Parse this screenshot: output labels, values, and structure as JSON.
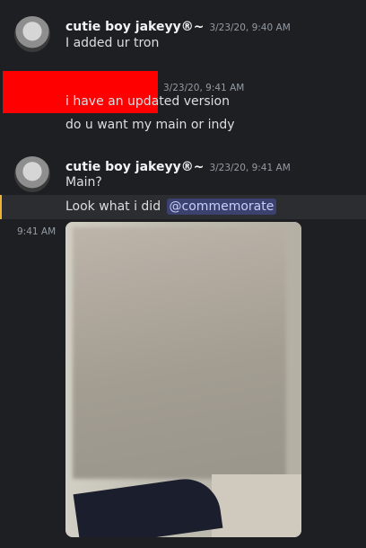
{
  "messages": [
    {
      "username": "cutie boy jakeyy®~",
      "timestamp": "3/23/20, 9:40 AM",
      "lines": [
        "I added ur tron"
      ]
    },
    {
      "username": "",
      "timestamp": "3/23/20, 9:41 AM",
      "lines": [
        "i have an updated version",
        "do u want my main or indy"
      ]
    },
    {
      "username": "cutie boy jakeyy®~",
      "timestamp": "3/23/20, 9:41 AM",
      "lines": [
        "Main?",
        "Look what i did"
      ],
      "mention": "@commemorate",
      "hover_time": "9:41 AM",
      "attachment": "image"
    }
  ],
  "colors": {
    "background": "#1e1f22",
    "highlight": "#2b2d31",
    "highlight_border": "#f0b232",
    "mention_bg": "#3c4270",
    "mention_text": "#c9cdfb",
    "redaction": "#ff0000"
  }
}
